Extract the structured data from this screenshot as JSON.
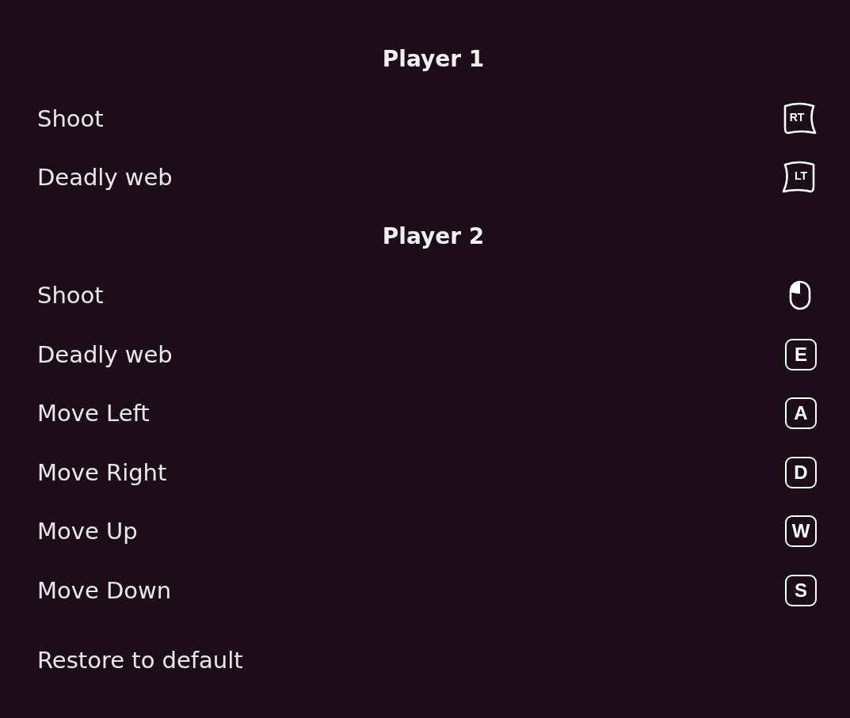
{
  "sections": [
    {
      "title": "Player 1",
      "rows": [
        {
          "action": "Shoot",
          "binding": {
            "kind": "right_trigger",
            "label": "RT"
          }
        },
        {
          "action": "Deadly web",
          "binding": {
            "kind": "left_trigger",
            "label": "LT"
          }
        }
      ]
    },
    {
      "title": "Player 2",
      "rows": [
        {
          "action": "Shoot",
          "binding": {
            "kind": "mouse"
          }
        },
        {
          "action": "Deadly web",
          "binding": {
            "kind": "key",
            "label": "E"
          }
        },
        {
          "action": "Move Left",
          "binding": {
            "kind": "key",
            "label": "A"
          }
        },
        {
          "action": "Move Right",
          "binding": {
            "kind": "key",
            "label": "D"
          }
        },
        {
          "action": "Move Up",
          "binding": {
            "kind": "key",
            "label": "W"
          }
        },
        {
          "action": "Move Down",
          "binding": {
            "kind": "key",
            "label": "S"
          }
        }
      ]
    }
  ],
  "restore_button": "Restore to default"
}
